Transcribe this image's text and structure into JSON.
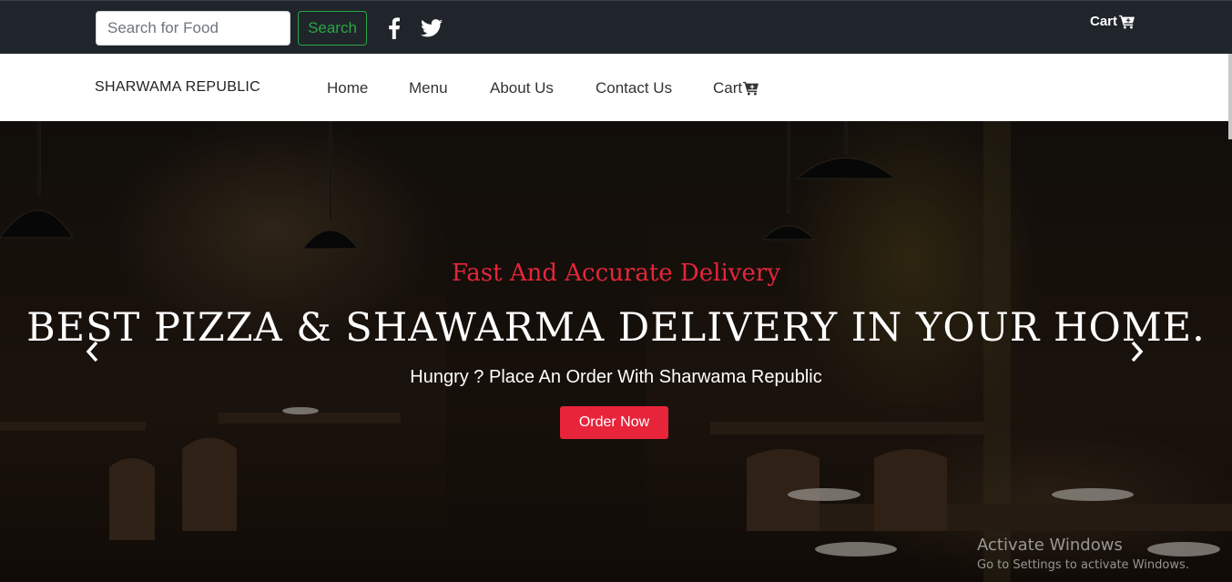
{
  "topbar": {
    "search_placeholder": "Search for Food",
    "search_button": "Search",
    "social": [
      "facebook-icon",
      "twitter-icon"
    ],
    "cart_label": "Cart"
  },
  "navbar": {
    "brand": "SHARWAMA REPUBLIC",
    "links": [
      {
        "label": "Home"
      },
      {
        "label": "Menu"
      },
      {
        "label": "About Us"
      },
      {
        "label": "Contact Us"
      },
      {
        "label": "Cart"
      }
    ]
  },
  "hero": {
    "subtitle": "Fast And Accurate Delivery",
    "title": "BEST PIZZA & SHAWARMA DELIVERY IN YOUR HOME.",
    "tagline": "Hungry ? Place An Order With Sharwama Republic",
    "order_button": "Order Now"
  },
  "watermark": {
    "line1": "Activate Windows",
    "line2": "Go to Settings to activate Windows."
  },
  "colors": {
    "topbar_bg": "#1f252b",
    "accent_red": "#e8243a",
    "search_green": "#28a745"
  }
}
